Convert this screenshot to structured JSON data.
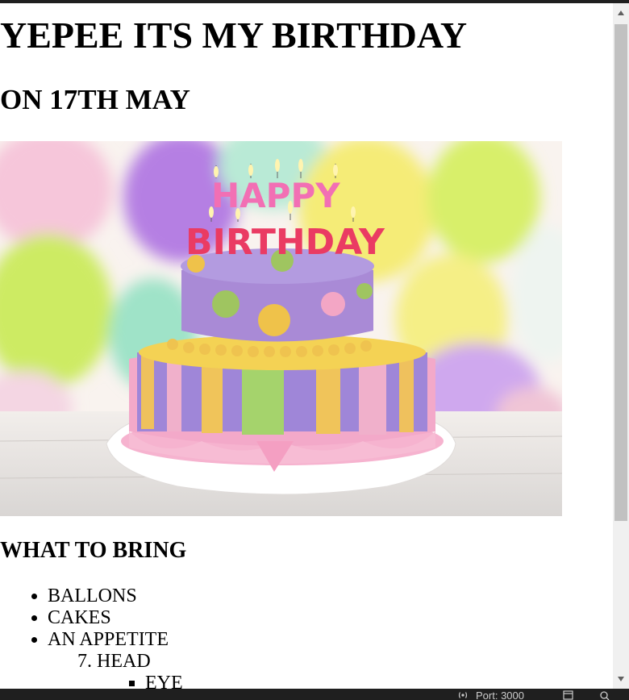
{
  "page": {
    "title": "YEPEE ITS MY BIRTHDAY",
    "subtitle": "ON 17TH MAY",
    "image": {
      "cake_text_top": "HAPPY",
      "cake_text_bottom": "BIRTHDAY"
    },
    "section_heading": "WHAT TO BRING",
    "bring_items": [
      "BALLONS",
      "CAKES",
      "AN APPETITE"
    ],
    "nested_item": {
      "number": "7.",
      "label": "HEAD"
    },
    "sub_item": "EYE"
  },
  "statusbar": {
    "port_label": "Port: 3000"
  },
  "icons": {
    "scroll_up": "caret-up-icon",
    "scroll_down": "caret-down-icon",
    "port": "broadcast-icon",
    "layout": "window-icon",
    "search": "search-icon"
  },
  "colors": {
    "statusbar": "#1f1f1f",
    "scroll_thumb": "#c1c1c1",
    "scroll_track": "#f0f0f0"
  }
}
